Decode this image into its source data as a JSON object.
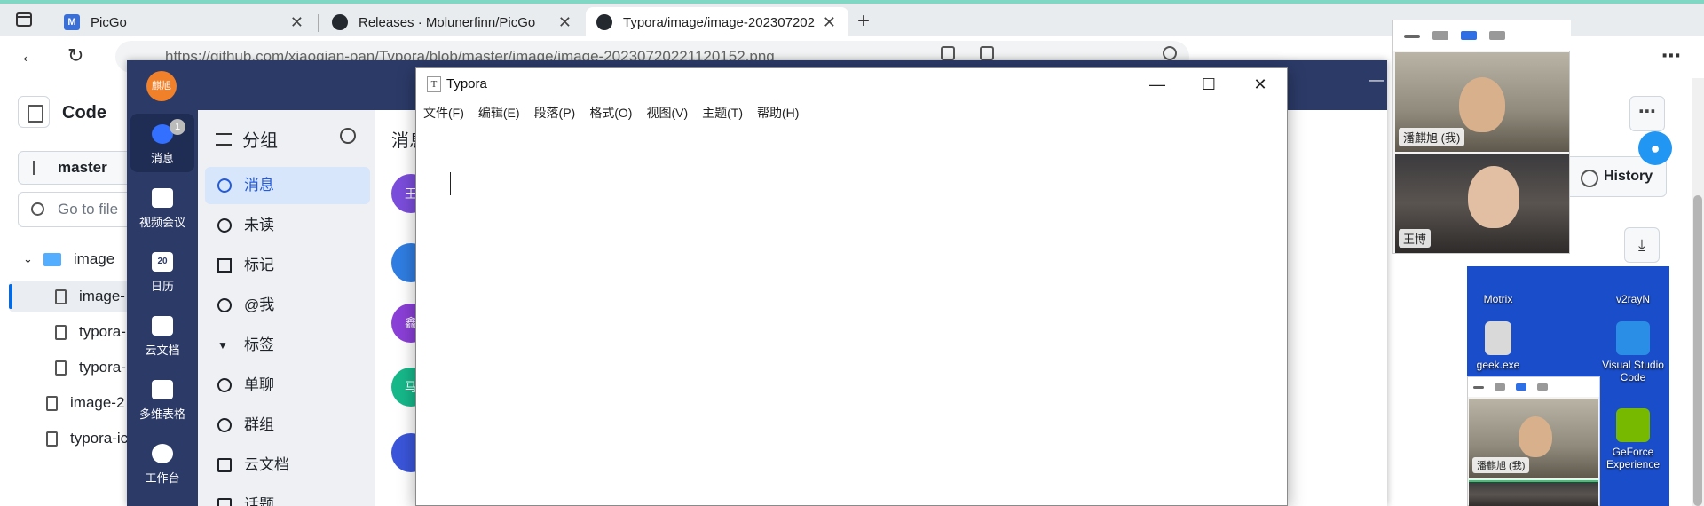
{
  "browser": {
    "tabs": [
      {
        "title": "PicGo",
        "favicon": "M",
        "favicon_color": "#3a6fd8"
      },
      {
        "title": "Releases · Molunerfinn/PicGo",
        "favicon": "github-icon",
        "favicon_color": "#24292f"
      },
      {
        "title": "Typora/image/image-202307202",
        "favicon": "github-icon",
        "favicon_color": "#24292f"
      }
    ],
    "url": "https://github.com/xiaoqian-pan/Typora/blob/master/image/image-20230720221120152.png"
  },
  "github": {
    "code_title": "Code",
    "branch": "master",
    "goto_placeholder": "Go to file",
    "tree": [
      {
        "name": "image",
        "type": "folder"
      },
      {
        "name": "image-",
        "type": "file"
      },
      {
        "name": "typora-",
        "type": "file"
      },
      {
        "name": "typora-",
        "type": "file"
      },
      {
        "name": "image-2",
        "type": "file"
      },
      {
        "name": "typora-ic",
        "type": "file"
      }
    ],
    "history_label": "History"
  },
  "lark": {
    "avatar_text": "麒旭",
    "rail": [
      {
        "label": "消息",
        "badge": "1"
      },
      {
        "label": "视频会议"
      },
      {
        "label": "日历",
        "icon_text": "20"
      },
      {
        "label": "云文档"
      },
      {
        "label": "多维表格"
      },
      {
        "label": "工作台"
      }
    ],
    "nav_title": "分组",
    "nav_items": [
      "消息",
      "未读",
      "标记",
      "@我",
      "标签",
      "单聊",
      "群组",
      "云文档",
      "话题"
    ],
    "main_title": "消息",
    "chat_avatars": [
      "王",
      "",
      "鑫",
      "马",
      ""
    ]
  },
  "typora": {
    "title": "Typora",
    "menu": [
      "文件(F)",
      "编辑(E)",
      "段落(P)",
      "格式(O)",
      "视图(V)",
      "主题(T)",
      "帮助(H)"
    ]
  },
  "video_call": {
    "participants": [
      "潘麒旭 (我)",
      "王博"
    ],
    "mini_participant": "潘麒旭 (我)"
  },
  "desktop": {
    "icons": [
      "Motrix",
      "v2rayN",
      "geek.exe",
      "Visual Studio Code",
      "GeForce Experience"
    ]
  }
}
